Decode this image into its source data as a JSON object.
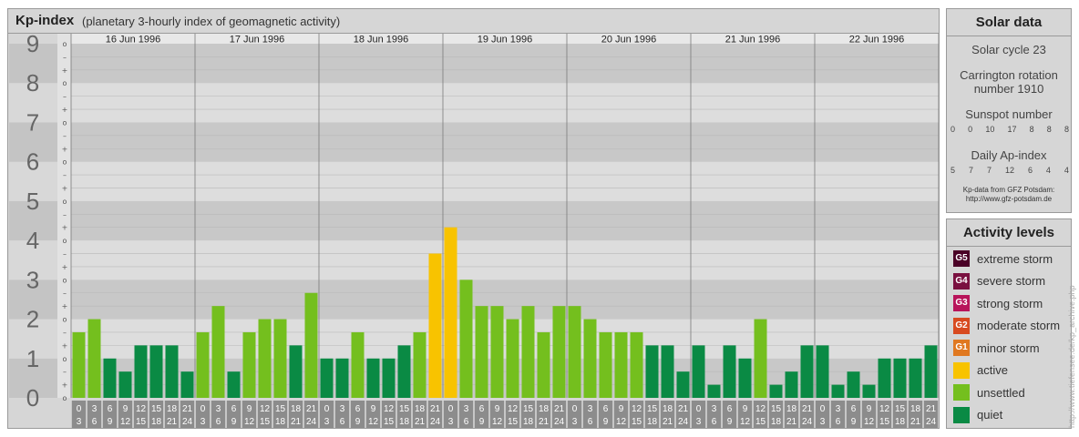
{
  "header": {
    "title": "Kp-index",
    "subtitle": "(planetary 3-hourly index of geomagnetic activity)"
  },
  "colors": {
    "quiet": "#0a8a44",
    "unsettled": "#74bf1e",
    "active": "#f8c300",
    "minor_storm": "#e07820",
    "moderate_storm": "#d84a20",
    "strong_storm": "#b8145a",
    "severe_storm": "#7a1040",
    "extreme_storm": "#4a0026"
  },
  "chart_data": {
    "type": "bar",
    "title": "Kp-index",
    "ylim": [
      0,
      9
    ],
    "y_ticks": [
      "0",
      "1",
      "2",
      "3",
      "4",
      "5",
      "6",
      "7",
      "8",
      "9"
    ],
    "minor_tick_labels": [
      "o",
      "+",
      "–"
    ],
    "dates": [
      "16 Jun 1996",
      "17 Jun 1996",
      "18 Jun 1996",
      "19 Jun 1996",
      "20 Jun 1996",
      "21 Jun 1996",
      "22 Jun 1996"
    ],
    "interval_start": [
      "0",
      "3",
      "6",
      "9",
      "12",
      "15",
      "18",
      "21"
    ],
    "interval_end": [
      "3",
      "6",
      "9",
      "12",
      "15",
      "18",
      "21",
      "24"
    ],
    "values": [
      [
        1.667,
        2.0,
        1.0,
        0.667,
        1.333,
        1.333,
        1.333,
        0.667
      ],
      [
        1.667,
        2.333,
        0.667,
        1.667,
        2.0,
        2.0,
        1.333,
        2.667
      ],
      [
        1.0,
        1.0,
        1.667,
        1.0,
        1.0,
        1.333,
        1.667,
        3.667
      ],
      [
        4.333,
        3.0,
        2.333,
        2.333,
        2.0,
        2.333,
        1.667,
        2.333
      ],
      [
        2.333,
        2.0,
        1.667,
        1.667,
        1.667,
        1.333,
        1.333,
        0.667
      ],
      [
        1.333,
        0.333,
        1.333,
        1.0,
        2.0,
        0.333,
        0.667,
        1.333
      ],
      [
        1.333,
        0.333,
        0.667,
        0.333,
        1.0,
        1.0,
        1.0,
        1.333
      ]
    ],
    "grid": true
  },
  "solar": {
    "heading": "Solar data",
    "cycle": "Solar cycle 23",
    "carrington_line1": "Carrington rotation",
    "carrington_line2": "number 1910",
    "sunspot_label": "Sunspot number",
    "sunspot_values": [
      "0",
      "0",
      "10",
      "17",
      "8",
      "8",
      "8"
    ],
    "ap_label": "Daily Ap-index",
    "ap_values": [
      "5",
      "7",
      "7",
      "12",
      "6",
      "4",
      "4"
    ],
    "credit_line1": "Kp-data from GFZ Potsdam:",
    "credit_line2": "http://www.gfz-potsdam.de"
  },
  "levels": {
    "heading": "Activity levels",
    "items": [
      {
        "badge": "G5",
        "label": "extreme storm",
        "color": "#4a0026"
      },
      {
        "badge": "G4",
        "label": "severe storm",
        "color": "#7a1040"
      },
      {
        "badge": "G3",
        "label": "strong storm",
        "color": "#b8145a"
      },
      {
        "badge": "G2",
        "label": "moderate storm",
        "color": "#d84a20"
      },
      {
        "badge": "G1",
        "label": "minor storm",
        "color": "#e07820"
      },
      {
        "badge": "",
        "label": "active",
        "color": "#f8c300"
      },
      {
        "badge": "",
        "label": "unsettled",
        "color": "#74bf1e"
      },
      {
        "badge": "",
        "label": "quiet",
        "color": "#0a8a44"
      }
    ]
  },
  "watermark": "http://www.tiefensee.de/kp_archive.php"
}
